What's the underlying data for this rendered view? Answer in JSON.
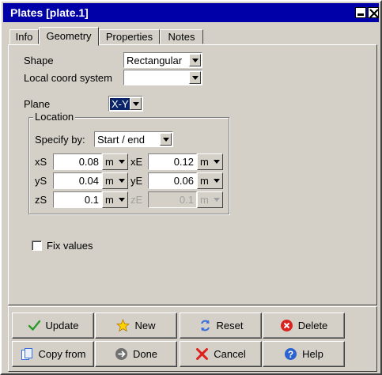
{
  "window": {
    "title": "Plates [plate.1]"
  },
  "tabs": [
    {
      "label": "Info"
    },
    {
      "label": "Geometry"
    },
    {
      "label": "Properties"
    },
    {
      "label": "Notes"
    }
  ],
  "geometry": {
    "shape": {
      "label": "Shape",
      "value": "Rectangular"
    },
    "local_coord": {
      "label": "Local coord system",
      "value": ""
    },
    "plane": {
      "label": "Plane",
      "value": "X-Y"
    },
    "location": {
      "title": "Location",
      "specify_by": {
        "label": "Specify by:",
        "value": "Start / end"
      },
      "xS": {
        "label": "xS",
        "value": "0.08",
        "unit": "m"
      },
      "yS": {
        "label": "yS",
        "value": "0.04",
        "unit": "m"
      },
      "zS": {
        "label": "zS",
        "value": "0.1",
        "unit": "m"
      },
      "xE": {
        "label": "xE",
        "value": "0.12",
        "unit": "m"
      },
      "yE": {
        "label": "yE",
        "value": "0.06",
        "unit": "m"
      },
      "zE": {
        "label": "zE",
        "value": "0.1",
        "unit": "m",
        "disabled": true
      }
    },
    "fix_values": {
      "label": "Fix values",
      "checked": false
    }
  },
  "buttons": {
    "update": "Update",
    "new": "New",
    "reset": "Reset",
    "delete": "Delete",
    "copy_from": "Copy from",
    "done": "Done",
    "cancel": "Cancel",
    "help": "Help"
  },
  "icons": {
    "update": "checkmark-icon",
    "new": "star-icon",
    "reset": "reset-arrows-icon",
    "delete": "delete-icon",
    "copy_from": "copy-icon",
    "done": "done-icon",
    "cancel": "cross-icon",
    "help": "help-icon"
  },
  "colors": {
    "titlebar": "#0000a8",
    "face": "#d4d0c8",
    "selection": "#0a246a"
  }
}
